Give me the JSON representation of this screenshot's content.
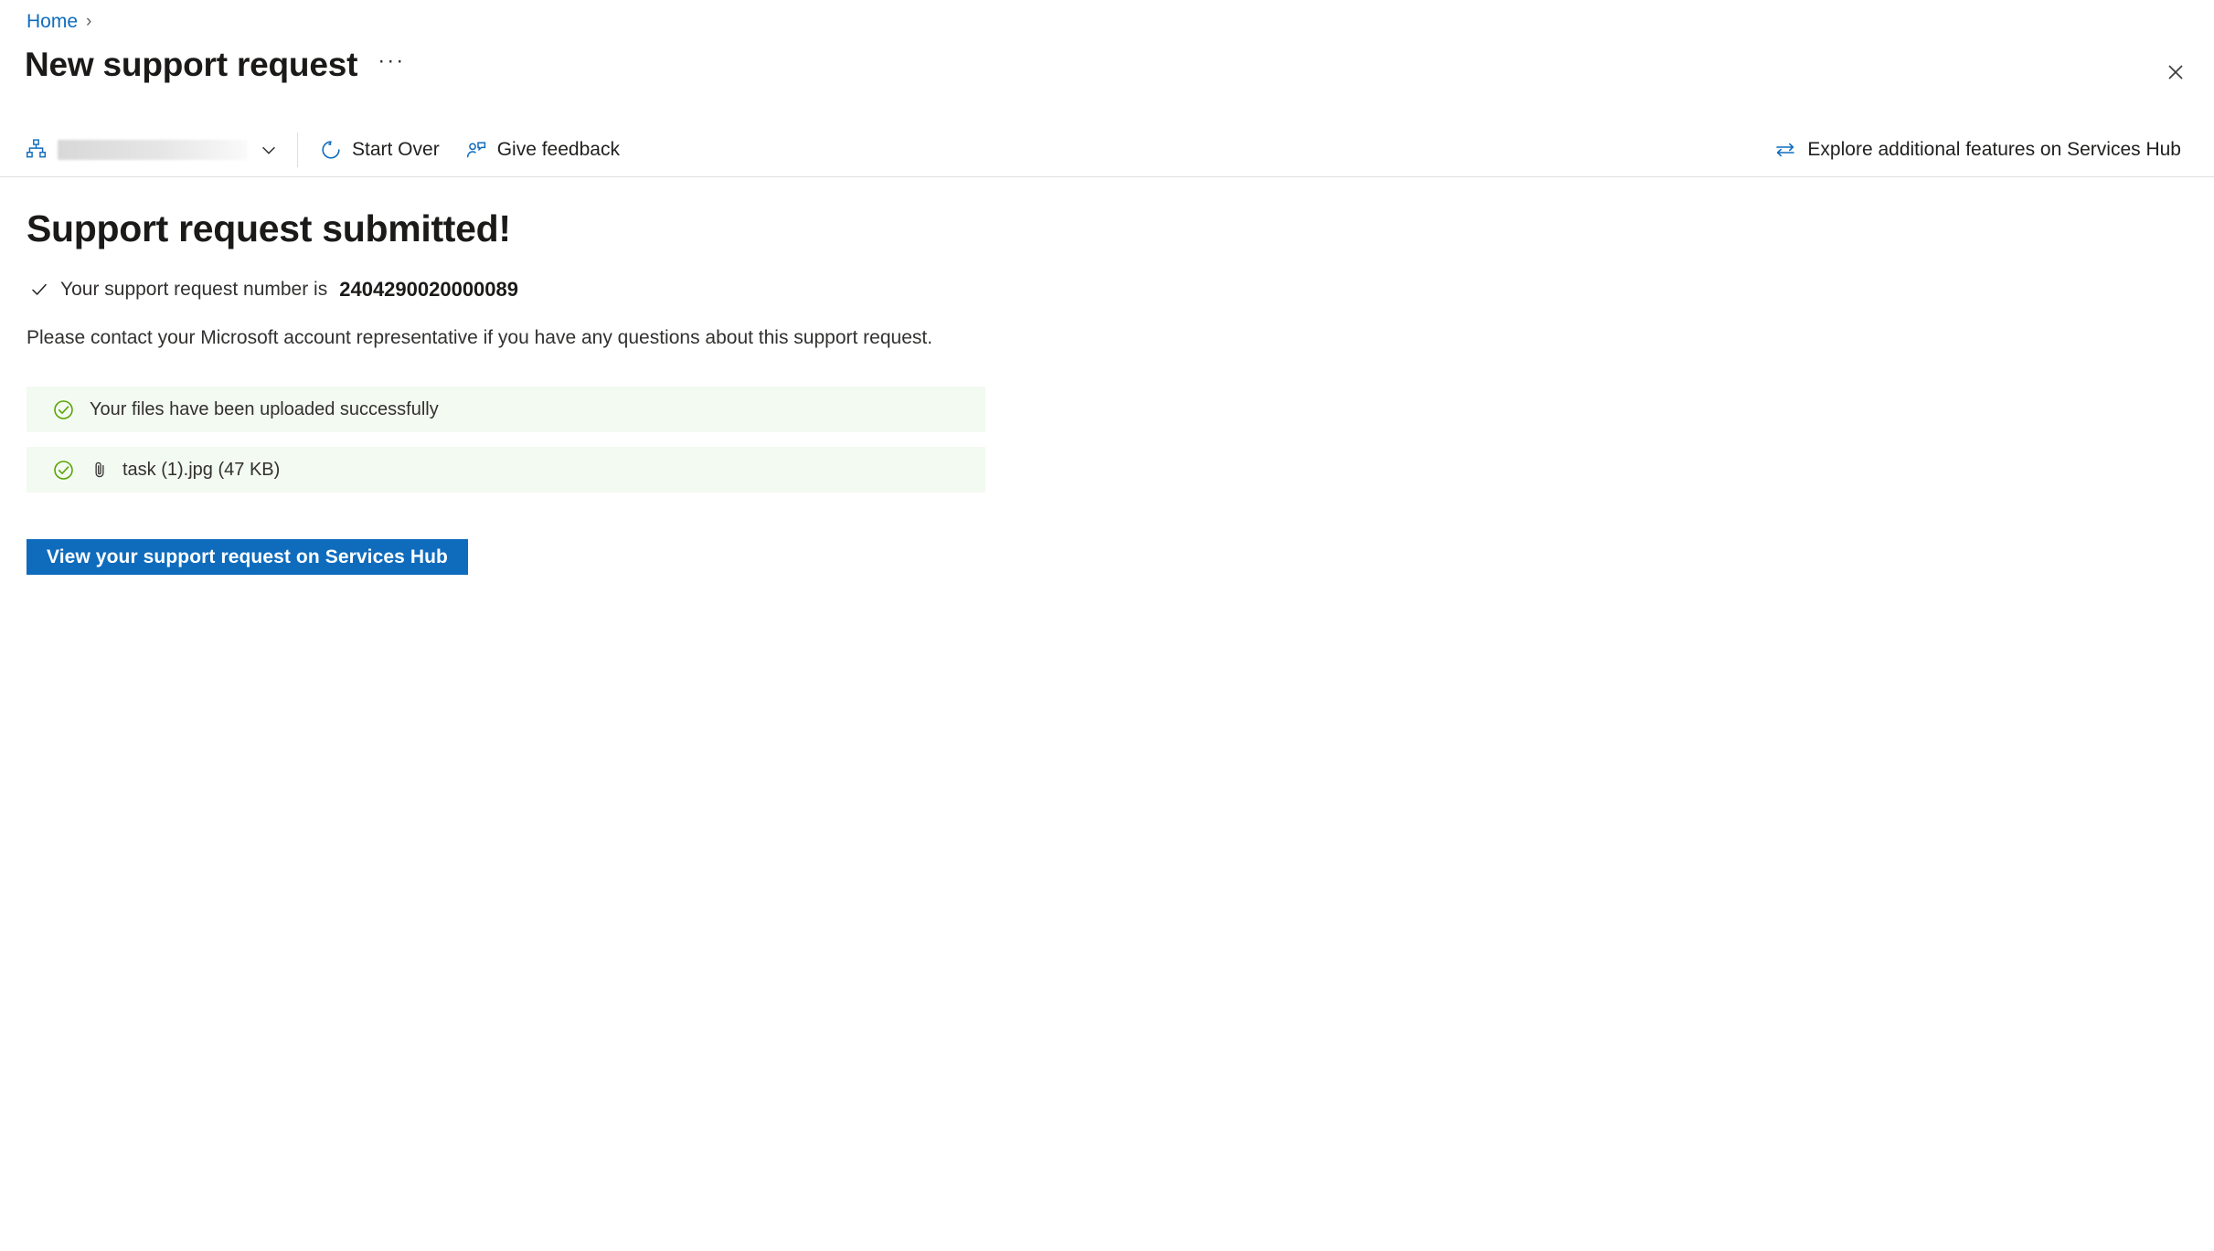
{
  "breadcrumb": {
    "items": [
      {
        "label": "Home",
        "separator": "›"
      }
    ]
  },
  "header": {
    "title": "New support request",
    "more_actions_label": "···",
    "close_label": "✕"
  },
  "commandbar": {
    "scope_selector": {
      "icon": "org-hierarchy-icon",
      "value": "",
      "value_redacted": true,
      "chevron": "chevron-down-icon"
    },
    "buttons": [
      {
        "label": "Start Over",
        "icon": "restart-icon"
      },
      {
        "label": "Give feedback",
        "icon": "person-feedback-icon"
      }
    ],
    "right_link": {
      "label": "Explore additional features on Services Hub",
      "icon": "swap-arrows-icon"
    }
  },
  "main": {
    "heading": "Support request submitted!",
    "request_number_prefix": "Your support request number is",
    "request_number": "2404290020000089",
    "contact_note": "Please contact your Microsoft account representative if you have any questions about this support request.",
    "banners": [
      {
        "icon": "circle-check-icon",
        "text": "Your files have been uploaded successfully",
        "has_attachment_icon": false
      },
      {
        "icon": "circle-check-icon",
        "text": "task (1).jpg (47 KB)",
        "has_attachment_icon": true,
        "attachment_icon": "paperclip-icon"
      }
    ],
    "primary_button": "View your support request on Services Hub"
  },
  "colors": {
    "accent_blue": "#0f6cbd",
    "link_blue": "#0f6cbd",
    "success_green": "#57a300",
    "banner_background": "#f3faf1",
    "text_primary": "#1b1a19",
    "text_secondary": "#323130",
    "border": "#e1dfdd",
    "page_background": "#ffffff"
  }
}
